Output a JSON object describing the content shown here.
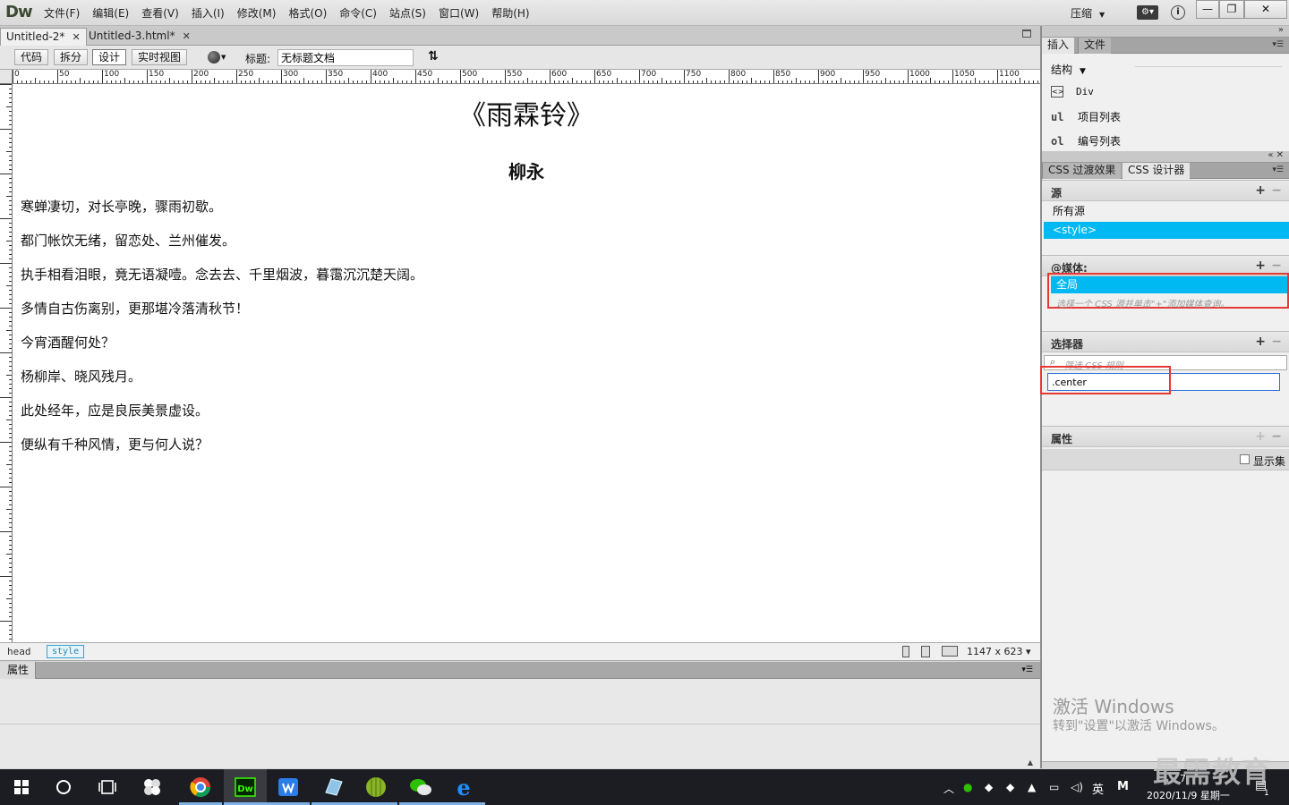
{
  "app": {
    "logo": "Dw",
    "menu": [
      "文件(F)",
      "编辑(E)",
      "查看(V)",
      "插入(I)",
      "修改(M)",
      "格式(O)",
      "命令(C)",
      "站点(S)",
      "窗口(W)",
      "帮助(H)"
    ],
    "layout_mode": "压缩",
    "window_controls": {
      "minimize": "—",
      "maximize": "❐",
      "close": "✕"
    }
  },
  "tabs": [
    {
      "label": "Untitled-2*",
      "active": true
    },
    {
      "label": "Untitled-3.html*",
      "active": false
    }
  ],
  "toolbar": {
    "views": [
      "代码",
      "拆分",
      "设计",
      "实时视图"
    ],
    "active_view": "设计",
    "title_label": "标题:",
    "title_value": "无标题文档"
  },
  "ruler": {
    "labels": [
      "0",
      "50",
      "100",
      "150",
      "200",
      "250",
      "300",
      "350",
      "400",
      "450",
      "500",
      "550",
      "600",
      "650",
      "700",
      "750",
      "800",
      "850",
      "900",
      "950",
      "1000",
      "1050",
      "1100"
    ]
  },
  "document": {
    "title": "《雨霖铃》",
    "author": "柳永",
    "lines": [
      "寒蝉凄切，对长亭晚，骤雨初歇。",
      "都门帐饮无绪，留恋处、兰州催发。",
      "执手相看泪眼，竟无语凝噎。念去去、千里烟波，暮霭沉沉楚天阔。",
      "多情自古伤离别，更那堪冷落清秋节！",
      "今宵酒醒何处？",
      "杨柳岸、晓风残月。",
      "此处经年，应是良辰美景虚设。",
      "便纵有千种风情，更与何人说？"
    ]
  },
  "statusbar": {
    "tag_head": "head",
    "tag_style": "style",
    "size": "1147 x 623 ▾"
  },
  "properties_panel": {
    "tab": "属性"
  },
  "insert_panel": {
    "tabs": [
      "插入",
      "文件"
    ],
    "category": "结构",
    "items": [
      {
        "icon": "div",
        "label": "Div"
      },
      {
        "icon": "ul",
        "label": "项目列表"
      },
      {
        "icon": "ol",
        "label": "编号列表"
      }
    ]
  },
  "css_panel": {
    "tabs": [
      "CSS 过渡效果",
      "CSS 设计器"
    ],
    "sources_title": "源",
    "sources": [
      "所有源",
      "<style>"
    ],
    "selected_source": "<style>",
    "media_title": "@媒体:",
    "media_item": "全局",
    "media_hint": "选择一个 CSS 源并单击\"+\"添加媒体查询。",
    "selectors_title": "选择器",
    "selector_filter_placeholder": "筛选 CSS 规则",
    "selector_input_value": ".center",
    "properties_title": "属性",
    "show_set_label": "显示集"
  },
  "watermark": {
    "line1": "激活 Windows",
    "line2": "转到\"设置\"以激活 Windows。",
    "brand": "最需教育"
  },
  "taskbar": {
    "tray_lang": "英",
    "tray_ime": "M",
    "time": "7",
    "date": "2020/11/9 星期一",
    "notif_count": "1"
  },
  "colors": {
    "selection": "#00b9f2",
    "highlight_box": "#e53935",
    "taskbar": "#1c1d22"
  }
}
